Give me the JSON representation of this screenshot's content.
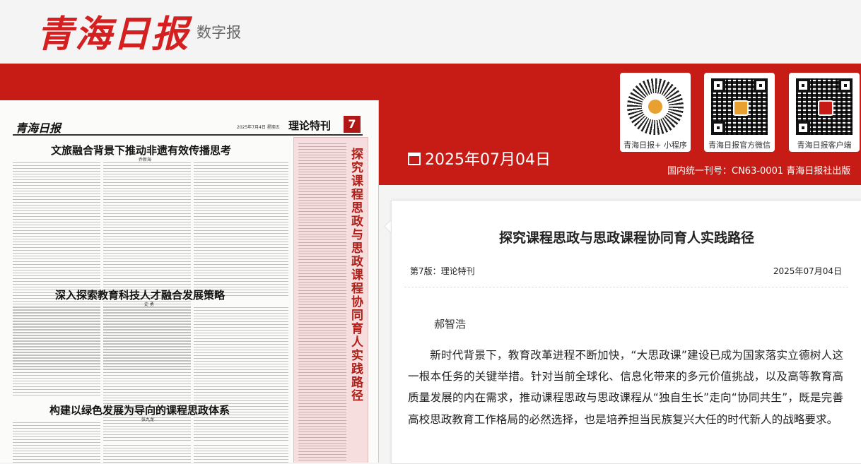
{
  "header": {
    "logo_text": "青海日报",
    "subtitle": "数字报"
  },
  "issue": {
    "date": "2025年07月04日",
    "issn": "国内统一刊号：CN63-0001 青海日报社出版"
  },
  "qr_codes": [
    {
      "label": "青海日报+ 小程序",
      "icon": "mini-program-code-icon"
    },
    {
      "label": "青海日报官方微信",
      "icon": "wechat-qr-icon"
    },
    {
      "label": "青海日报客户端",
      "icon": "app-qr-icon"
    }
  ],
  "newspaper_page": {
    "masthead": "青海日报",
    "date_line": "2025年7月4日  星期五",
    "section": "理论特刊",
    "page_number": "7",
    "articles": [
      {
        "title": "文旅融合背景下推动非遗有效传播思考",
        "author": "乔新海"
      },
      {
        "title": "深入探索教育科技人才融合发展策略",
        "author": "史  勇"
      },
      {
        "title": "构建以绿色发展为导向的课程思政体系",
        "author": "张九龙"
      }
    ],
    "vertical_title": "探究课程思政与思政课程协同育人实践路径"
  },
  "article": {
    "title": "探究课程思政与思政课程协同育人实践路径",
    "page_info": "第7版：理论特刊",
    "date": "2025年07月04日",
    "author": "郝智浩",
    "paragraph": "新时代背景下，教育改革进程不断加快，“大思政课”建设已成为国家落实立德树人这一根本任务的关键举措。针对当前全球化、信息化带来的多元价值挑战，以及高等教育高质量发展的内在需求，推动课程思政与思政课程从“独自生长”走向“协同共生”，既是完善高校思政教育工作格局的必然选择，也是培养担当民族复兴大任的时代新人的战略要求。"
  },
  "colors": {
    "brand_red": "#c71c16",
    "logo_red": "#d42020",
    "highlight_pink": "#f6dede"
  }
}
